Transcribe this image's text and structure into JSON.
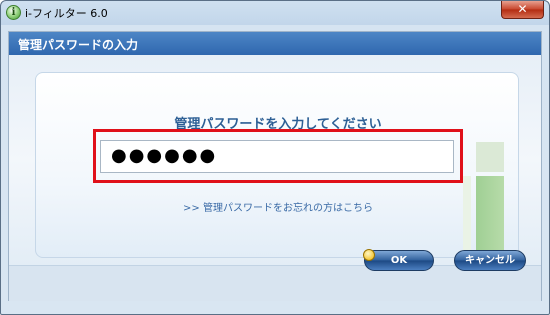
{
  "window": {
    "app_icon_glyph": "i",
    "title": "i-フィルター 6.0",
    "close_glyph": "✕"
  },
  "header": {
    "title": "管理パスワードの入力"
  },
  "form": {
    "prompt": "管理パスワードを入力してください",
    "password_value": "●●●●●●",
    "forgot_link": ">> 管理パスワードをお忘れの方はこちら"
  },
  "buttons": {
    "ok_label": "OK",
    "cancel_label": "キャンセル"
  },
  "colors": {
    "header_blue": "#3a73b8",
    "highlight_red": "#e0101a",
    "button_blue": "#2f5f9c"
  },
  "icons": {
    "app": "i-filter-app-icon",
    "close": "close-icon",
    "ok": "shield-icon"
  }
}
